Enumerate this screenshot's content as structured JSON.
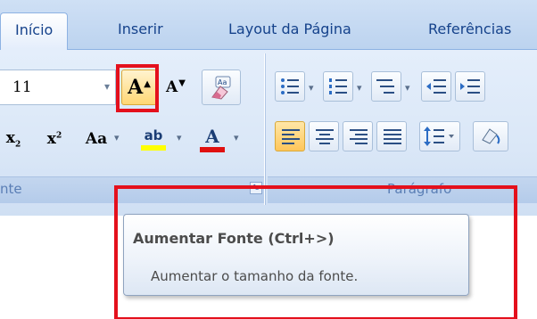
{
  "tabs": [
    {
      "label": "Início",
      "active": true
    },
    {
      "label": "Inserir",
      "active": false
    },
    {
      "label": "Layout da Página",
      "active": false
    },
    {
      "label": "Referências",
      "active": false
    }
  ],
  "font_group": {
    "font_size": "11",
    "grow_font_button": "A",
    "shrink_font_button": "A",
    "subscript_label": "x",
    "subscript_mark": "2",
    "superscript_label": "x",
    "superscript_mark": "2",
    "change_case_label": "Aa",
    "highlight_label": "ab",
    "font_color_label": "A",
    "group_label": "nte"
  },
  "paragraph_group": {
    "group_label": "Parágrafo"
  },
  "tooltip": {
    "title": "Aumentar Fonte (Ctrl+>)",
    "description": "Aumentar o tamanho da fonte."
  },
  "colors": {
    "annotation_red": "#e4101c",
    "highlight_yellow": "#ffff00",
    "font_color_red": "#e01010",
    "active_button": "#ffd775"
  },
  "icons": [
    "bullets-icon",
    "numbering-icon",
    "multilevel-list-icon",
    "decrease-indent-icon",
    "increase-indent-icon",
    "clear-formatting-icon",
    "align-left-icon",
    "center-icon",
    "align-right-icon",
    "justify-icon",
    "line-spacing-icon",
    "shading-icon",
    "dialog-launcher-icon"
  ]
}
